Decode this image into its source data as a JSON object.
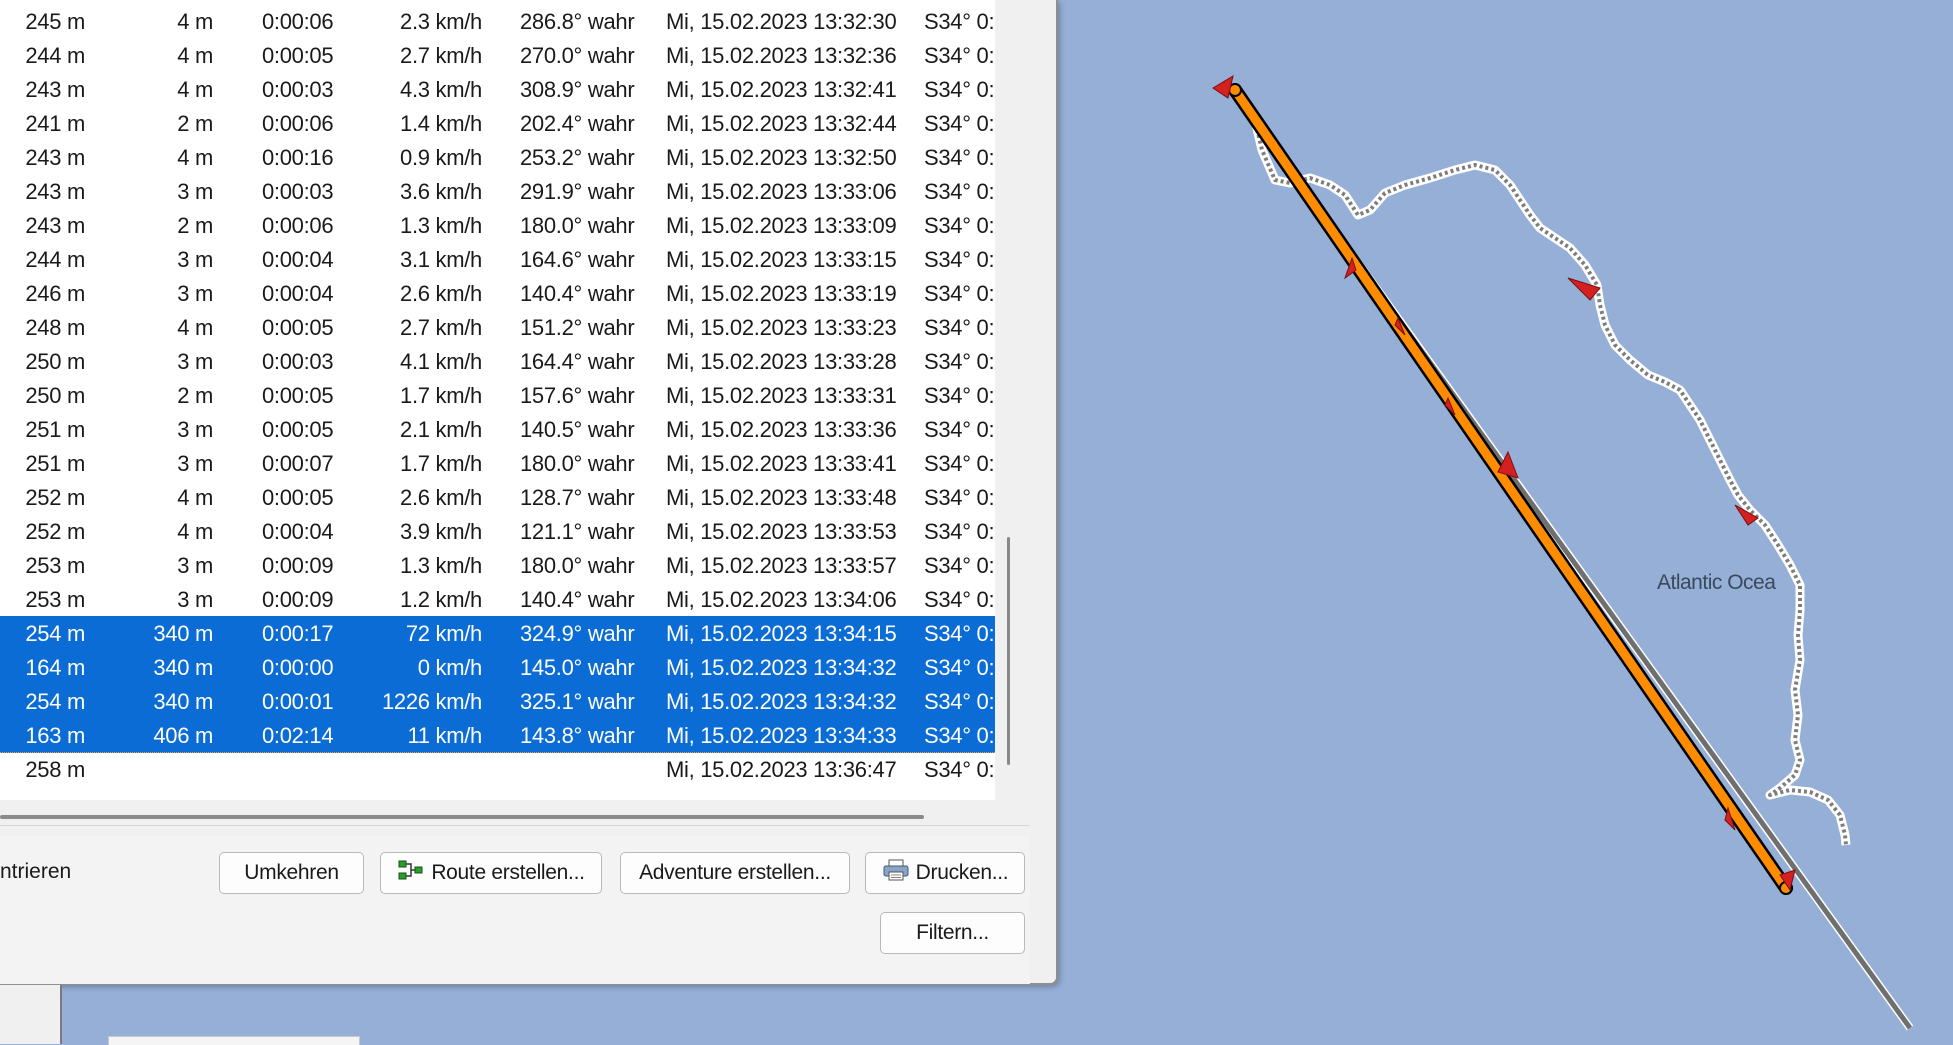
{
  "table": {
    "rows": [
      {
        "alt": "245 m",
        "dist": "4 m",
        "dur": "0:00:06",
        "speed": "2.3 km/h",
        "course": "286.8° wahr",
        "time": "Mi, 15.02.2023 13:32:30",
        "pos": "S34° 0:",
        "selected": false
      },
      {
        "alt": "244 m",
        "dist": "4 m",
        "dur": "0:00:05",
        "speed": "2.7 km/h",
        "course": "270.0° wahr",
        "time": "Mi, 15.02.2023 13:32:36",
        "pos": "S34° 0:",
        "selected": false
      },
      {
        "alt": "243 m",
        "dist": "4 m",
        "dur": "0:00:03",
        "speed": "4.3 km/h",
        "course": "308.9° wahr",
        "time": "Mi, 15.02.2023 13:32:41",
        "pos": "S34° 0:",
        "selected": false
      },
      {
        "alt": "241 m",
        "dist": "2 m",
        "dur": "0:00:06",
        "speed": "1.4 km/h",
        "course": "202.4° wahr",
        "time": "Mi, 15.02.2023 13:32:44",
        "pos": "S34° 0:",
        "selected": false
      },
      {
        "alt": "243 m",
        "dist": "4 m",
        "dur": "0:00:16",
        "speed": "0.9 km/h",
        "course": "253.2° wahr",
        "time": "Mi, 15.02.2023 13:32:50",
        "pos": "S34° 0:",
        "selected": false
      },
      {
        "alt": "243 m",
        "dist": "3 m",
        "dur": "0:00:03",
        "speed": "3.6 km/h",
        "course": "291.9° wahr",
        "time": "Mi, 15.02.2023 13:33:06",
        "pos": "S34° 0:",
        "selected": false
      },
      {
        "alt": "243 m",
        "dist": "2 m",
        "dur": "0:00:06",
        "speed": "1.3 km/h",
        "course": "180.0° wahr",
        "time": "Mi, 15.02.2023 13:33:09",
        "pos": "S34° 0:",
        "selected": false
      },
      {
        "alt": "244 m",
        "dist": "3 m",
        "dur": "0:00:04",
        "speed": "3.1 km/h",
        "course": "164.6° wahr",
        "time": "Mi, 15.02.2023 13:33:15",
        "pos": "S34° 0:",
        "selected": false
      },
      {
        "alt": "246 m",
        "dist": "3 m",
        "dur": "0:00:04",
        "speed": "2.6 km/h",
        "course": "140.4° wahr",
        "time": "Mi, 15.02.2023 13:33:19",
        "pos": "S34° 0:",
        "selected": false
      },
      {
        "alt": "248 m",
        "dist": "4 m",
        "dur": "0:00:05",
        "speed": "2.7 km/h",
        "course": "151.2° wahr",
        "time": "Mi, 15.02.2023 13:33:23",
        "pos": "S34° 0:",
        "selected": false
      },
      {
        "alt": "250 m",
        "dist": "3 m",
        "dur": "0:00:03",
        "speed": "4.1 km/h",
        "course": "164.4° wahr",
        "time": "Mi, 15.02.2023 13:33:28",
        "pos": "S34° 0:",
        "selected": false
      },
      {
        "alt": "250 m",
        "dist": "2 m",
        "dur": "0:00:05",
        "speed": "1.7 km/h",
        "course": "157.6° wahr",
        "time": "Mi, 15.02.2023 13:33:31",
        "pos": "S34° 0:",
        "selected": false
      },
      {
        "alt": "251 m",
        "dist": "3 m",
        "dur": "0:00:05",
        "speed": "2.1 km/h",
        "course": "140.5° wahr",
        "time": "Mi, 15.02.2023 13:33:36",
        "pos": "S34° 0:",
        "selected": false
      },
      {
        "alt": "251 m",
        "dist": "3 m",
        "dur": "0:00:07",
        "speed": "1.7 km/h",
        "course": "180.0° wahr",
        "time": "Mi, 15.02.2023 13:33:41",
        "pos": "S34° 0:",
        "selected": false
      },
      {
        "alt": "252 m",
        "dist": "4 m",
        "dur": "0:00:05",
        "speed": "2.6 km/h",
        "course": "128.7° wahr",
        "time": "Mi, 15.02.2023 13:33:48",
        "pos": "S34° 0:",
        "selected": false
      },
      {
        "alt": "252 m",
        "dist": "4 m",
        "dur": "0:00:04",
        "speed": "3.9 km/h",
        "course": "121.1° wahr",
        "time": "Mi, 15.02.2023 13:33:53",
        "pos": "S34° 0:",
        "selected": false
      },
      {
        "alt": "253 m",
        "dist": "3 m",
        "dur": "0:00:09",
        "speed": "1.3 km/h",
        "course": "180.0° wahr",
        "time": "Mi, 15.02.2023 13:33:57",
        "pos": "S34° 0:",
        "selected": false
      },
      {
        "alt": "253 m",
        "dist": "3 m",
        "dur": "0:00:09",
        "speed": "1.2 km/h",
        "course": "140.4° wahr",
        "time": "Mi, 15.02.2023 13:34:06",
        "pos": "S34° 0:",
        "selected": false
      },
      {
        "alt": "254 m",
        "dist": "340 m",
        "dur": "0:00:17",
        "speed": "72 km/h",
        "course": "324.9° wahr",
        "time": "Mi, 15.02.2023 13:34:15",
        "pos": "S34° 0:",
        "selected": true
      },
      {
        "alt": "164 m",
        "dist": "340 m",
        "dur": "0:00:00",
        "speed": "0 km/h",
        "course": "145.0° wahr",
        "time": "Mi, 15.02.2023 13:34:32",
        "pos": "S34° 0:",
        "selected": true
      },
      {
        "alt": "254 m",
        "dist": "340 m",
        "dur": "0:00:01",
        "speed": "1226 km/h",
        "course": "325.1° wahr",
        "time": "Mi, 15.02.2023 13:34:32",
        "pos": "S34° 0:",
        "selected": true
      },
      {
        "alt": "163 m",
        "dist": "406 m",
        "dur": "0:02:14",
        "speed": "11 km/h",
        "course": "143.8° wahr",
        "time": "Mi, 15.02.2023 13:34:33",
        "pos": "S34° 0:",
        "selected": true
      },
      {
        "alt": "258 m",
        "dist": "",
        "dur": "",
        "speed": "",
        "course": "",
        "time": "Mi, 15.02.2023 13:36:47",
        "pos": "S34° 0:",
        "selected": false
      }
    ]
  },
  "panel": {
    "left_label": "ntrieren",
    "reverse_button": "Umkehren",
    "create_route_button": "Route erstellen...",
    "create_adventure_button": "Adventure erstellen...",
    "print_button": "Drucken...",
    "filter_button": "Filtern..."
  },
  "map": {
    "label": "Atlantic Ocea",
    "track_color": "#ff8c00",
    "background_color": "#95afd6",
    "marker_color": "#d42020"
  },
  "icons": {
    "route": "route-icon",
    "print": "printer-icon"
  }
}
